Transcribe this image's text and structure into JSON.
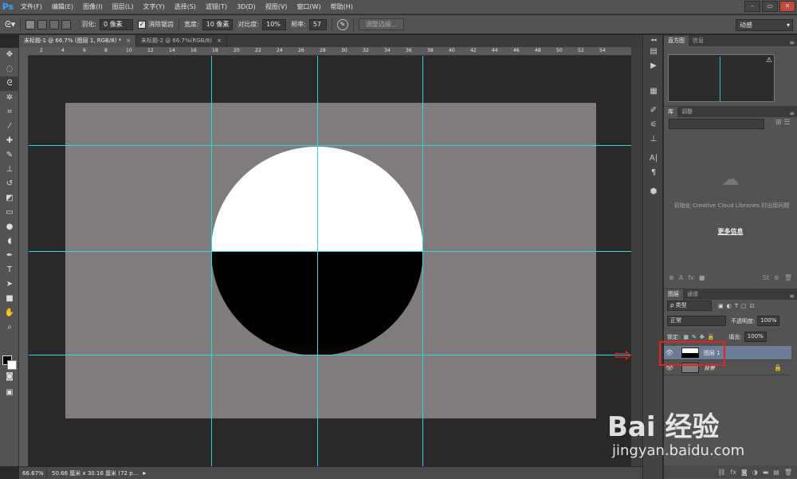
{
  "app": {
    "logo": "Ps"
  },
  "menu": [
    "文件(F)",
    "编辑(E)",
    "图像(I)",
    "图层(L)",
    "文字(Y)",
    "选择(S)",
    "滤镜(T)",
    "3D(D)",
    "视图(V)",
    "窗口(W)",
    "帮助(H)"
  ],
  "window_controls": [
    "–",
    "▭",
    "✕"
  ],
  "options": {
    "feather_label": "羽化:",
    "feather_value": "0 像素",
    "antialias_label": "消除锯齿",
    "width_label": "宽度:",
    "width_value": "10 像素",
    "contrast_label": "对比度:",
    "contrast_value": "10%",
    "freq_label": "频率:",
    "freq_value": "57",
    "refine_label": "调整边缘...",
    "workspace": "动感"
  },
  "tabs": [
    {
      "label": "未标题-1 @ 66.7% (图层 1, RGB/8) *",
      "close": "×"
    },
    {
      "label": "未标题-2 @ 66.7%(RGB/8)",
      "close": "×"
    }
  ],
  "ruler_top_labels": [
    "2",
    "4",
    "6",
    "8",
    "10",
    "12",
    "14",
    "16",
    "18",
    "20",
    "22",
    "24",
    "26",
    "28",
    "30",
    "32",
    "34",
    "36",
    "38",
    "40",
    "42",
    "44",
    "46",
    "48",
    "50",
    "52",
    "54"
  ],
  "canvas": {
    "doc_color": "#807c7b",
    "guide_color": "#33d6e3"
  },
  "status": {
    "zoom": "66.67%",
    "doc_info": "50.66 厘米 x 30.16 厘米 (72 p..."
  },
  "panels": {
    "histogram_tabs": [
      "直方图",
      "信息"
    ],
    "library_tabs": [
      "库",
      "调整"
    ],
    "library_message": "初始化 Creative Cloud Libraries 时出现问题",
    "library_more": "更多信息",
    "layers_tabs": [
      "图层",
      "通道"
    ],
    "kind_label": "ρ 类型",
    "blend_mode": "正常",
    "opacity_label": "不透明度:",
    "opacity_value": "100%",
    "lock_label": "锁定:",
    "fill_label": "填充:",
    "fill_value": "100%",
    "layers": [
      {
        "name": "图层 1",
        "selected": true
      },
      {
        "name": "背景",
        "selected": false
      }
    ]
  },
  "watermark": {
    "brand": "Bai  经验",
    "url": "jingyan.baidu.com"
  },
  "annotation_arrow": "⇨"
}
